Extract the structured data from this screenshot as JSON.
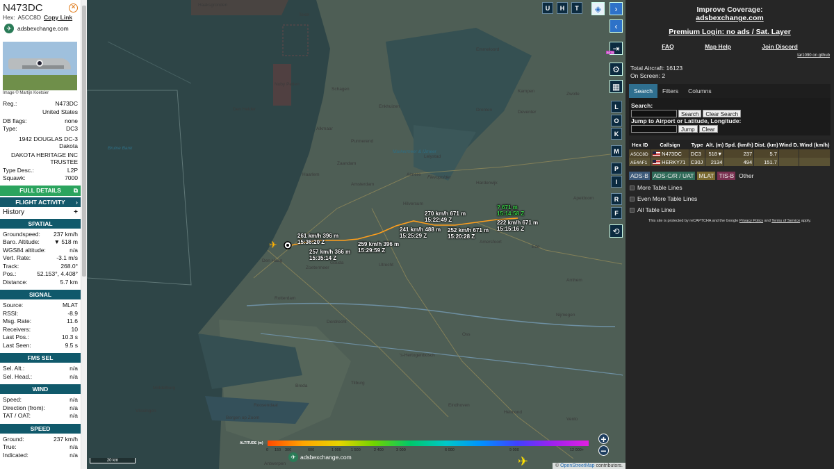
{
  "panel": {
    "callsign": "N473DC",
    "hex_label": "Hex:",
    "hex": "A5CC8D",
    "copy_link": "Copy Link",
    "site": "adsbexchange.com",
    "photo_credit": "Image © Martijn Koetsier",
    "reg_label": "Reg.:",
    "reg": "N473DC",
    "country": "United States",
    "dbflags_label": "DB flags:",
    "dbflags": "none",
    "type_label": "Type:",
    "type": "DC3",
    "model": "1942 DOUGLAS DC-3",
    "model2": "Dakota",
    "owner": "DAKOTA HERITAGE INC",
    "owner2": "TRUSTEE",
    "typedesc_label": "Type Desc.:",
    "typedesc": "L2P",
    "squawk_label": "Squawk:",
    "squawk": "7000",
    "full_details": "FULL DETAILS",
    "flight_activity": "FLIGHT ACTIVITY",
    "history": "History",
    "sections": {
      "spatial": "SPATIAL",
      "signal": "SIGNAL",
      "fms": "FMS SEL",
      "wind": "WIND",
      "speed": "SPEED"
    },
    "spatial": [
      {
        "k": "Groundspeed:",
        "v": "237 km/h"
      },
      {
        "k": "Baro. Altitude:",
        "v": "▼ 518 m"
      },
      {
        "k": "WGS84 altitude:",
        "v": "n/a"
      },
      {
        "k": "Vert. Rate:",
        "v": "-3.1 m/s"
      },
      {
        "k": "Track:",
        "v": "268.0°"
      },
      {
        "k": "Pos.:",
        "v": "52.153°, 4.408°"
      },
      {
        "k": "Distance:",
        "v": "5.7 km"
      }
    ],
    "signal": [
      {
        "k": "Source:",
        "v": "MLAT"
      },
      {
        "k": "RSSI:",
        "v": "-8.9"
      },
      {
        "k": "Msg. Rate:",
        "v": "11.6"
      },
      {
        "k": "Receivers:",
        "v": "10"
      },
      {
        "k": "Last Pos.:",
        "v": "10.3 s"
      },
      {
        "k": "Last Seen:",
        "v": "9.5 s"
      }
    ],
    "fms": [
      {
        "k": "Sel. Alt.:",
        "v": "n/a"
      },
      {
        "k": "Sel. Head.:",
        "v": "n/a"
      }
    ],
    "wind": [
      {
        "k": "Speed:",
        "v": "n/a"
      },
      {
        "k": "Direction (from):",
        "v": "n/a"
      },
      {
        "k": "TAT / OAT:",
        "v": "n/a"
      }
    ],
    "speed": [
      {
        "k": "Ground:",
        "v": "237 km/h"
      },
      {
        "k": "True:",
        "v": "n/a"
      },
      {
        "k": "Indicated:",
        "v": "n/a"
      }
    ]
  },
  "map": {
    "labels": {
      "haaksgronden": "Haaksgronden",
      "texel": "Texel",
      "den_helder": "Den Helder",
      "noby": "Noby Petten",
      "schagen": "Schagen",
      "alkmaar": "Alkmaar",
      "purmerend": "Purmerend",
      "zaandam": "Zaandam",
      "haarlem": "Haarlem",
      "amsterdam": "Amsterdam",
      "almere": "Almere",
      "lelystad": "Lelystad",
      "hilversum": "Hilversum",
      "amersfoort": "Amersfoort",
      "leiden": "Leiden",
      "den_haag": "Den Haag",
      "zoetermeer": "Zoetermeer",
      "rotterdam": "Rotterdam",
      "dordrecht": "Dordrecht",
      "utrecht": "Utrecht",
      "apeldoorn": "Apeldoorn",
      "deventer": "Deventer",
      "zwolle": "Zwolle",
      "enkhuizen": "Enkhuizen",
      "harderwijk": "Harderwijk",
      "ede": "Ede",
      "arnhem": "Arnhem",
      "nijmegen": "Nijmegen",
      "hertogenbosch": "'s-Hertogenbosch",
      "tilburg": "Tilburg",
      "breda": "Breda",
      "eindhoven": "Eindhoven",
      "helmond": "Helmond",
      "venlo": "Venlo",
      "roosendaal": "Roosendaal",
      "bergen_op_zoom": "Bergen op Zoom",
      "vlissingen": "Vlissingen",
      "middelburg": "Middelburg",
      "antwerpen": "Antwerpen",
      "oss": "Oss",
      "gouda": "Gouda",
      "emmeloord": "Emmeloord",
      "dronten": "Dronten",
      "kampen": "Kampen",
      "markermeer": "Markermeer & IJmeer",
      "bruine_bank": "Bruine Bank",
      "flevopolder": "Flevopolder"
    },
    "track_labels": [
      {
        "a": "261 km/h  396 m",
        "b": "15:36:20 Z"
      },
      {
        "a": "257 km/h  366 m",
        "b": "15:35:14 Z"
      },
      {
        "a": "259 km/h  396 m",
        "b": "15:29:59 Z"
      },
      {
        "a": "241 km/h  488 m",
        "b": "15:25:29 Z"
      },
      {
        "a": "270 km/h  671 m",
        "b": "15:22:49 Z"
      },
      {
        "a": "252 km/h  671 m",
        "b": "15:20:28 Z"
      },
      {
        "a": "222 km/h  671 m",
        "b": "15:15:16 Z"
      },
      {
        "a": "?  671 m",
        "b": "15:14:58 Z"
      }
    ],
    "buttons": {
      "u": "U",
      "h": "H",
      "t": "T",
      "l": "L",
      "o": "O",
      "k": "K",
      "m": "M",
      "p": "P",
      "i": "I",
      "r": "R",
      "f": "F",
      "beta": "BETA"
    },
    "altitude_title": "ALTITUDE (m)",
    "altitude_ticks": [
      "0",
      "150",
      "300",
      "600",
      "1 000",
      "1 500",
      "2 400",
      "3 000",
      "6 000",
      "9 000",
      "12 000+"
    ],
    "brand": "adsbexchange.com",
    "scale": "20 km",
    "attribution_prefix": "©",
    "attribution_link": "OpenStreetMap",
    "attribution_suffix": "contributors."
  },
  "right": {
    "improve": "Improve Coverage:",
    "improve_link": "adsbexchange.com",
    "premium": "Premium Login: no ads / Sat. Layer",
    "faq": "FAQ",
    "map_help": "Map Help",
    "discord": "Join Discord",
    "github": "tar1090 on github",
    "total_label": "Total Aircraft:",
    "total": "16123",
    "onscreen_label": "On Screen:",
    "onscreen": "2",
    "tabs": [
      "Search",
      "Filters",
      "Columns"
    ],
    "search_title": "Search:",
    "search_btn": "Search",
    "clear_search": "Clear Search",
    "jump_title": "Jump to Airport or Latitude, Longitude:",
    "jump_btn": "Jump",
    "clear_btn": "Clear",
    "columns": [
      "Hex ID",
      "Callsign",
      "Type",
      "Alt. (m)",
      "Spd. (km/h)",
      "Dist. (km)",
      "Wind D.",
      "Wind (km/h)"
    ],
    "rows": [
      {
        "hex": "A5CC8D",
        "call": "N473DC",
        "type": "DC3",
        "alt": "518▼",
        "spd": "237",
        "dist": "5.7",
        "wd": "",
        "w": ""
      },
      {
        "hex": "AE4AF1",
        "call": "HERKY71",
        "type": "C30J",
        "alt": "2134",
        "spd": "494",
        "dist": "151.7",
        "wd": "",
        "w": ""
      }
    ],
    "sources": [
      "ADS-B",
      "ADS-C/R / UAT",
      "MLAT",
      "TIS-B",
      "Other"
    ],
    "more_lines": "More Table Lines",
    "even_more": "Even More Table Lines",
    "all_lines": "All Table Lines",
    "captcha_prefix": "This site is protected by reCAPTCHA and the Google",
    "privacy": "Privacy Policy",
    "and": "and",
    "terms": "Terms of Service",
    "apply": "apply."
  },
  "colors": {
    "accent": "#2ba45e",
    "header": "#10596b",
    "track": "#ff9f1c",
    "row": "#4f452b"
  }
}
